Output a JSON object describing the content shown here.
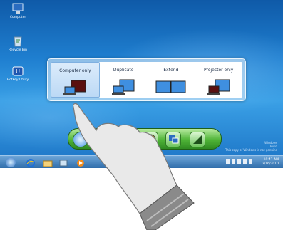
{
  "desktop": {
    "icons": [
      {
        "label": "Computer",
        "icon": "computer-icon"
      },
      {
        "label": "Recycle Bin",
        "icon": "recycle-bin-icon"
      },
      {
        "label": "Hotkey Utility",
        "icon": "hotkey-utility-icon"
      }
    ]
  },
  "display_switch": {
    "options": [
      {
        "label": "Computer only",
        "selected": true
      },
      {
        "label": "Duplicate",
        "selected": false
      },
      {
        "label": "Extend",
        "selected": false
      },
      {
        "label": "Projector only",
        "selected": false
      }
    ]
  },
  "dock": {
    "buttons": [
      "power-icon",
      "network-icon",
      "mute-icon",
      "radiation-icon",
      "display-switch-icon",
      "brightness-icon"
    ]
  },
  "taskbar": {
    "items": [
      "start-orb-icon",
      "internet-explorer-icon",
      "folder-icon",
      "media-player-icon",
      "play-icon"
    ],
    "clock_time": "10:41 AM",
    "clock_date": "2/16/2010"
  },
  "watermark": {
    "line1": "Windows",
    "line2": "Build",
    "line3": "This copy of Windows is not genuine"
  },
  "colors": {
    "desktop_blue": "#1f7fd0",
    "dock_green": "#4fb437",
    "selection_blue": "#bcd9f5"
  }
}
